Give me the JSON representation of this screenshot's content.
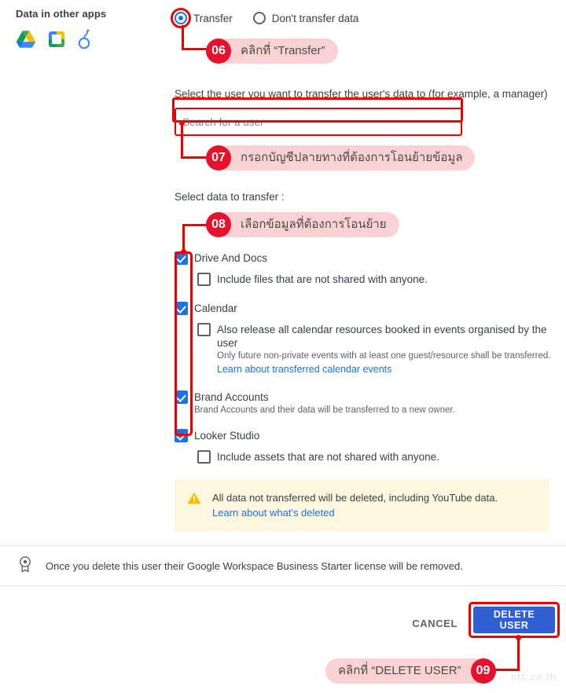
{
  "left_panel": {
    "title": "Data in other apps",
    "icons": [
      "google-drive-icon",
      "google-classroom-icon",
      "looker-studio-icon"
    ]
  },
  "transfer_options": {
    "transfer_label": "Transfer",
    "dont_transfer_label": "Don't transfer data",
    "selected": "Transfer"
  },
  "user_picker": {
    "helper": "Select the user you want to transfer the user's data to (for example, a manager)",
    "placeholder": "Search for a user",
    "value": ""
  },
  "data_section": {
    "label": "Select data to transfer :",
    "items": [
      {
        "label": "Drive And Docs",
        "checked": true,
        "sub_checkbox": {
          "label": "Include files that are not shared with anyone.",
          "checked": false
        }
      },
      {
        "label": "Calendar",
        "checked": true,
        "sub_checkbox": {
          "label": "Also release all calendar resources booked in events organised by the user",
          "checked": false
        },
        "note": "Only future non-private events with at least one guest/resource shall be transferred.",
        "link": "Learn about transferred calendar events"
      },
      {
        "label": "Brand Accounts",
        "checked": true,
        "note": "Brand Accounts and their data will be transferred to a new owner."
      },
      {
        "label": "Looker Studio",
        "checked": true,
        "sub_checkbox": {
          "label": "Include assets that are not shared with anyone.",
          "checked": false
        }
      }
    ]
  },
  "warning": {
    "icon": "warning-triangle-icon",
    "text": "All data not transferred will be deleted, including YouTube data.",
    "link": "Learn about what's deleted"
  },
  "license_notice": {
    "icon": "license-badge-icon",
    "text": "Once you delete this user their Google Workspace Business Starter license will be removed."
  },
  "footer": {
    "cancel_label": "CANCEL",
    "delete_label": "DELETE USER"
  },
  "annotations": [
    {
      "number": "06",
      "text": "คลิกที่ “Transfer”"
    },
    {
      "number": "07",
      "text": "กรอกบัญชีปลายทางที่ต้องการโอนย้ายข้อมูล"
    },
    {
      "number": "08",
      "text": "เลือกข้อมูลที่ต้องการโอนย้าย"
    },
    {
      "number": "09",
      "text": "คลิกที่ “DELETE USER”"
    }
  ],
  "watermark": "nts.co.th",
  "colors": {
    "annotation_red": "#ef0000",
    "annotation_badge": "#e8112d",
    "annotation_pill": "#fbd2d4",
    "checkbox_blue": "#1a73e8",
    "button_blue": "#2f5fd0",
    "warning_bg": "#fef7e0",
    "link_blue": "#1a73e8"
  }
}
